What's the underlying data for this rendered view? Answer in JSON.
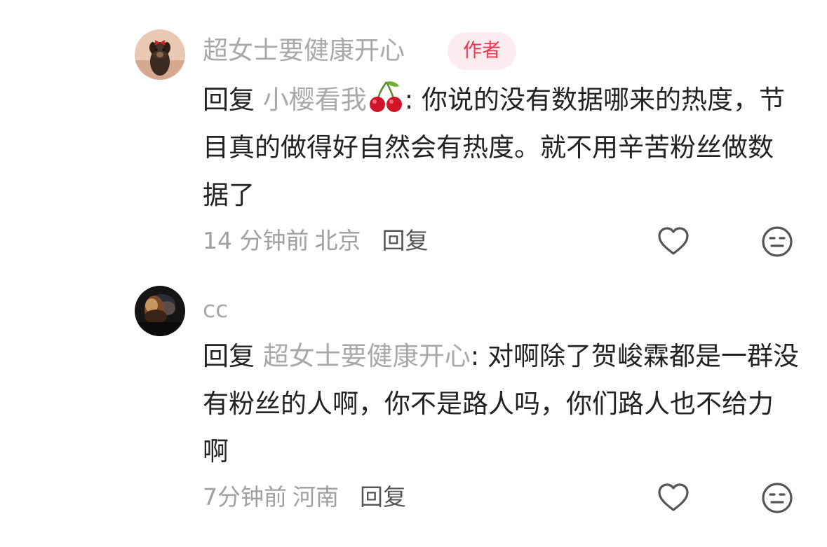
{
  "comments": [
    {
      "username": "超女士要健康开心",
      "badge": "作者",
      "reply_word": "回复",
      "reply_target": "小樱看我",
      "target_emoji": "cherries-icon",
      "colon": ":",
      "text": "你说的没有数据哪来的热度，节目真的做得好自然会有热度。就不用辛苦粉丝做数据了",
      "time": "14 分钟前",
      "location": "北京",
      "reply_button": "回复",
      "avatar": "dog-with-red-bow-avatar"
    },
    {
      "username": "cc",
      "reply_word": "回复",
      "reply_target": "超女士要健康开心",
      "colon": ":",
      "text": "对啊除了贺峻霖都是一群没有粉丝的人啊，你不是路人吗，你们路人也不给力啊",
      "time": "7分钟前",
      "location": "河南",
      "reply_button": "回复",
      "avatar": "dark-portrait-avatar"
    }
  ],
  "icons": {
    "like": "heart-outline-icon",
    "dislike": "neutral-face-icon"
  },
  "colors": {
    "badge_text": "#f0364f",
    "badge_bg": "#fdecef",
    "muted_text": "#a9a9a9",
    "body_text": "#222222",
    "icon_stroke": "#555555"
  }
}
